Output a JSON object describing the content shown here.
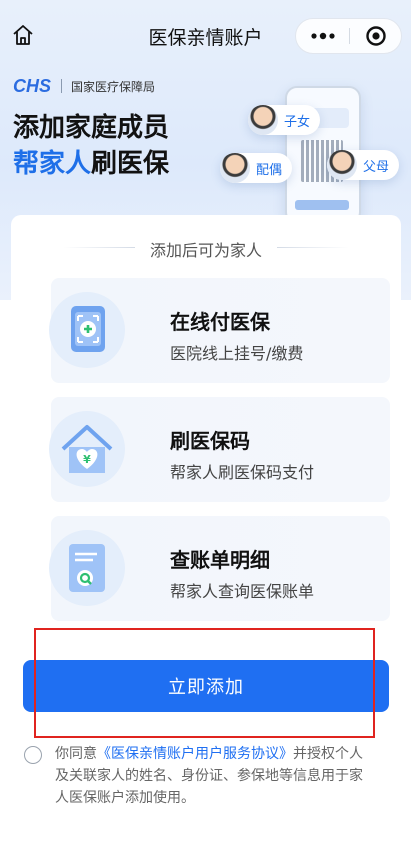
{
  "nav": {
    "title": "医保亲情账户",
    "home_icon": "home-icon",
    "more_icon": "more-dots-icon",
    "close_icon": "close-circle-icon"
  },
  "brand": {
    "logo": "CHS",
    "name": "国家医疗保障局"
  },
  "hero": {
    "headline_line1": "添加家庭成员",
    "headline_line2_accent": "帮家人",
    "headline_line2_rest": "刷医保",
    "members": [
      "子女",
      "配偶",
      "父母"
    ]
  },
  "card": {
    "subtitle": "添加后可为家人",
    "features": [
      {
        "icon": "card-plus-icon",
        "title": "在线付医保",
        "desc": "医院线上挂号/缴费"
      },
      {
        "icon": "house-heart-icon",
        "title": "刷医保码",
        "desc": "帮家人刷医保码支付"
      },
      {
        "icon": "bill-search-icon",
        "title": "查账单明细",
        "desc": "帮家人查询医保账单"
      }
    ]
  },
  "action": {
    "add_label": "立即添加"
  },
  "agreement": {
    "prefix": "你同意",
    "link": "《医保亲情账户用户服务协议》",
    "suffix1": "并授权个人",
    "line2": "及关联家人的姓名、身份证、参保地等信息用于家",
    "line3": "人医保账户添加使用。"
  },
  "colors": {
    "accent": "#1f6ff2",
    "highlight_box": "#e0241f",
    "hero_bg": "#e8f0fb"
  }
}
